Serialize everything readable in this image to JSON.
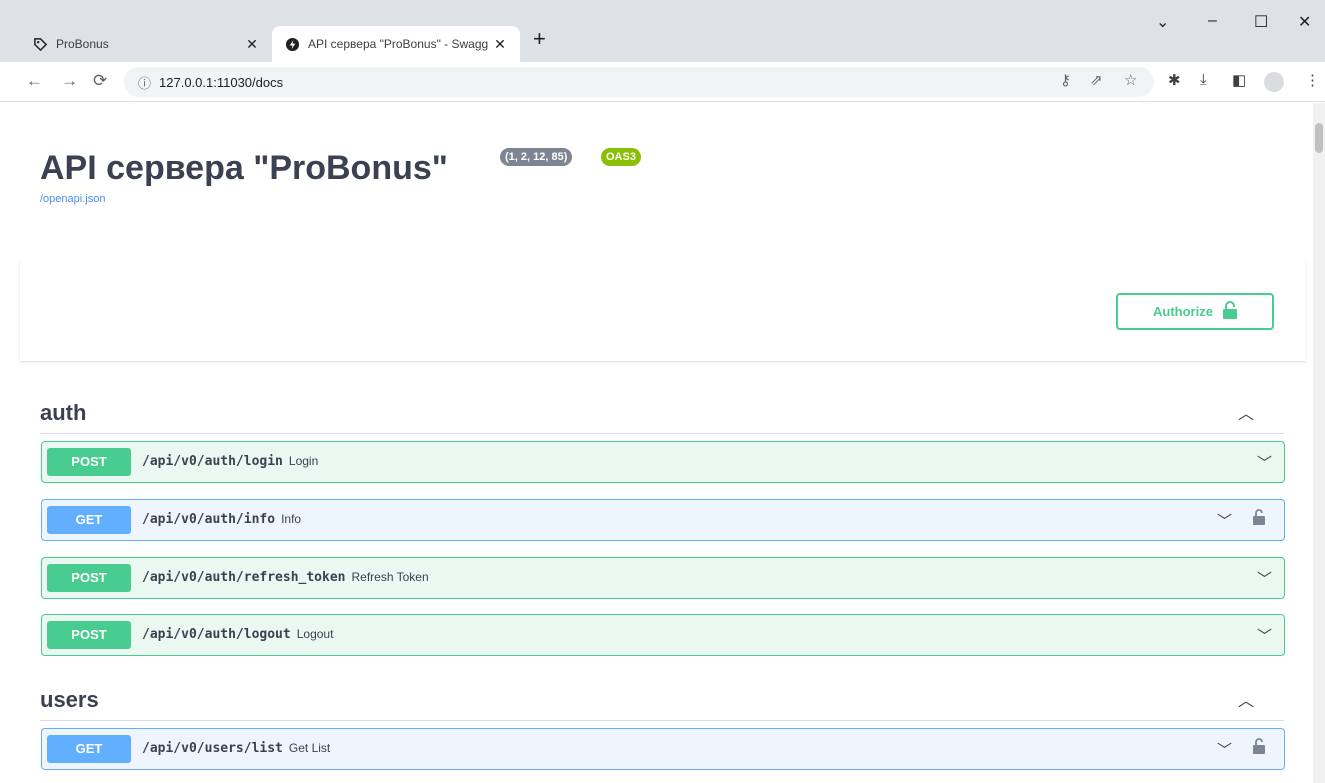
{
  "browser": {
    "tabs": [
      {
        "title": "ProBonus"
      },
      {
        "title": "API сервера \"ProBonus\" - Swagg"
      }
    ],
    "address": "127.0.0.1:11030/docs"
  },
  "page": {
    "title": "API сервера \"ProBonus\"",
    "version_badge": "(1, 2, 12, 85)",
    "oas_badge": "OAS3",
    "openapi_link": "/openapi.json",
    "authorize_label": "Authorize"
  },
  "sections": [
    {
      "name": "auth",
      "operations": [
        {
          "method": "POST",
          "path": "/api/v0/auth/login",
          "summary": "Login",
          "locked": false
        },
        {
          "method": "GET",
          "path": "/api/v0/auth/info",
          "summary": "Info",
          "locked": true
        },
        {
          "method": "POST",
          "path": "/api/v0/auth/refresh_token",
          "summary": "Refresh Token",
          "locked": false
        },
        {
          "method": "POST",
          "path": "/api/v0/auth/logout",
          "summary": "Logout",
          "locked": false
        }
      ]
    },
    {
      "name": "users",
      "operations": [
        {
          "method": "GET",
          "path": "/api/v0/users/list",
          "summary": "Get List",
          "locked": true
        }
      ]
    }
  ],
  "colors": {
    "post": "#49cc90",
    "get": "#61affe",
    "text": "#3b4151"
  }
}
